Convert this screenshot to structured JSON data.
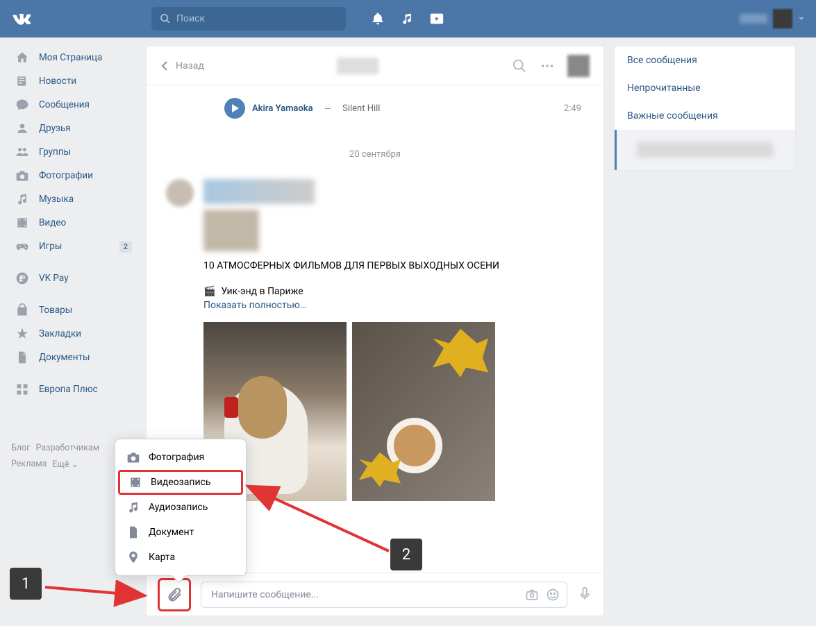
{
  "topbar": {
    "search_placeholder": "Поиск"
  },
  "sidebar": {
    "items": [
      {
        "label": "Моя Страница",
        "icon": "home"
      },
      {
        "label": "Новости",
        "icon": "news"
      },
      {
        "label": "Сообщения",
        "icon": "messages"
      },
      {
        "label": "Друзья",
        "icon": "friends"
      },
      {
        "label": "Группы",
        "icon": "groups"
      },
      {
        "label": "Фотографии",
        "icon": "photos"
      },
      {
        "label": "Музыка",
        "icon": "music"
      },
      {
        "label": "Видео",
        "icon": "video"
      },
      {
        "label": "Игры",
        "icon": "games",
        "badge": "2"
      }
    ],
    "vkpay_label": "VK Pay",
    "extra": [
      {
        "label": "Товары",
        "icon": "shop"
      },
      {
        "label": "Закладки",
        "icon": "star"
      },
      {
        "label": "Документы",
        "icon": "doc"
      }
    ],
    "europa_label": "Европа Плюс",
    "footer": [
      "Блог",
      "Разработчикам",
      "Реклама",
      "Ещё ⌄"
    ]
  },
  "chat": {
    "back_label": "Назад",
    "audio": {
      "artist": "Akira Yamaoka",
      "title": "Silent Hill",
      "duration": "2:49"
    },
    "date_divider": "20 сентября",
    "post": {
      "headline": "10 АТМОСФЕРНЫХ ФИЛЬМОВ ДЛЯ ПЕРВЫХ ВЫХОДНЫХ ОСЕНИ",
      "movie_emoji": "🎬",
      "movie_title": "Уик-энд в Париже",
      "show_more": "Показать полностью…"
    },
    "input_placeholder": "Напишите сообщение..."
  },
  "filters": {
    "items": [
      "Все сообщения",
      "Непрочитанные",
      "Важные сообщения"
    ]
  },
  "attach_menu": {
    "items": [
      {
        "label": "Фотография",
        "icon": "camera"
      },
      {
        "label": "Видеозапись",
        "icon": "video",
        "highlighted": true
      },
      {
        "label": "Аудиозапись",
        "icon": "audio"
      },
      {
        "label": "Документ",
        "icon": "doc"
      },
      {
        "label": "Карта",
        "icon": "map"
      }
    ]
  },
  "annotations": {
    "one": "1",
    "two": "2"
  }
}
